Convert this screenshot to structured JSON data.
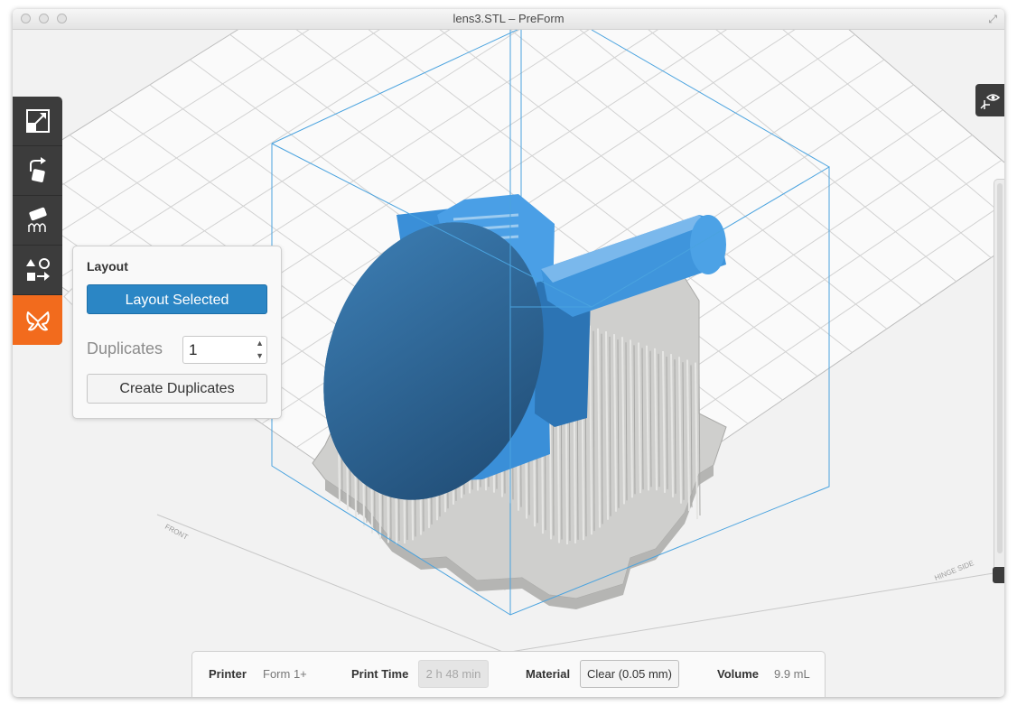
{
  "window": {
    "title": "lens3.STL – PreForm"
  },
  "toolbar": {
    "tools": [
      {
        "name": "scale",
        "icon": "scale-icon"
      },
      {
        "name": "orient",
        "icon": "orient-icon"
      },
      {
        "name": "supports",
        "icon": "supports-icon"
      },
      {
        "name": "layout",
        "icon": "layout-icon"
      },
      {
        "name": "print",
        "icon": "print-butterfly-icon",
        "active": true
      }
    ]
  },
  "layout_panel": {
    "title": "Layout",
    "layout_selected_label": "Layout Selected",
    "duplicates_label": "Duplicates",
    "duplicates_value": "1",
    "create_duplicates_label": "Create Duplicates"
  },
  "viewport": {
    "front_label": "FRONT",
    "hinge_label": "HINGE SIDE",
    "model_color": "#3a8fd8",
    "support_color": "#c9c9c7",
    "volume_color": "#4aa3df"
  },
  "view_control": {
    "icon": "view-eye-icon"
  },
  "status_bar": {
    "printer_label": "Printer",
    "printer_value": "Form 1+",
    "print_time_label": "Print Time",
    "print_time_value": "2 h 48 min",
    "material_label": "Material",
    "material_value": "Clear (0.05 mm)",
    "volume_label": "Volume",
    "volume_value": "9.9 mL"
  },
  "colors": {
    "accent": "#f26b1d",
    "primary_button": "#2b86c5",
    "toolbar": "#3c3c3c"
  }
}
